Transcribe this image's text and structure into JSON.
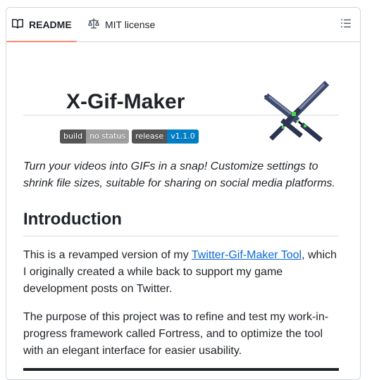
{
  "tabs": {
    "readme": "README",
    "license": "MIT license"
  },
  "readme": {
    "title": "X-Gif-Maker",
    "badges": [
      {
        "label": "build",
        "value": "no status",
        "color": "#9f9f9f"
      },
      {
        "label": "release",
        "value": "v1.1.0",
        "color": "#007ec6"
      }
    ],
    "tagline": "Turn your videos into GIFs in a snap! Customize settings to shrink file sizes, suitable for sharing on social media platforms.",
    "intro_heading": "Introduction",
    "p1_before": "This is a revamped version of my ",
    "p1_link": "Twitter-Gif-Maker Tool",
    "p1_after": ", which I originally created a while back to support my game development posts on Twitter.",
    "p2": "The purpose of this project was to refine and test my work-in-progress framework called Fortress, and to optimize the tool with an elegant interface for easier usability."
  },
  "colors": {
    "active_tab_underline": "#fd8c73",
    "link": "#0969da",
    "logo_blade": "#3d4a6b",
    "logo_accent": "#4bd34b"
  },
  "icons": [
    "book-icon",
    "scale-icon",
    "list-icon",
    "crossed-swords-logo"
  ]
}
